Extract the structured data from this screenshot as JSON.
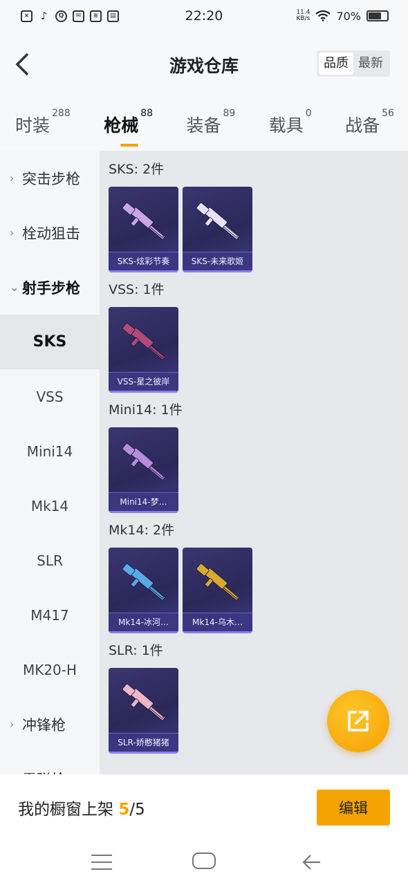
{
  "status_bar": {
    "time": "22:20",
    "net_speed_value": "11.4",
    "net_speed_unit": "KB/s",
    "battery": "70%",
    "battery_level": 0.7,
    "app_icons": [
      "file-icon",
      "tiktok-icon",
      "q-icon",
      "mail-icon",
      "app-icon",
      "card-icon"
    ]
  },
  "header": {
    "title": "游戏仓库",
    "sort_options": [
      "品质",
      "最新"
    ],
    "active_sort": "品质"
  },
  "tabs": [
    {
      "label": "时装",
      "count": "288"
    },
    {
      "label": "枪械",
      "count": "88",
      "active": true
    },
    {
      "label": "装备",
      "count": "89"
    },
    {
      "label": "载具",
      "count": "0"
    },
    {
      "label": "战备",
      "count": "56"
    }
  ],
  "sidebar": {
    "groups": [
      {
        "label": "突击步枪"
      },
      {
        "label": "栓动狙击"
      },
      {
        "label": "射手步枪"
      }
    ],
    "subitems": [
      "SKS",
      "VSS",
      "Mini14",
      "Mk14",
      "SLR",
      "M417",
      "MK20-H"
    ],
    "selected": "SKS",
    "after_groups": [
      {
        "label": "冲锋枪"
      },
      {
        "label": "霰弹枪"
      }
    ]
  },
  "sections": [
    {
      "title": "SKS: 2件",
      "items": [
        {
          "label": "SKS-炫彩节奏",
          "color": "#c9a6e8"
        },
        {
          "label": "SKS-未来歌姬",
          "color": "#e8e0f4"
        }
      ]
    },
    {
      "title": "VSS: 1件",
      "items": [
        {
          "label": "VSS-星之彼岸",
          "color": "#b04a78"
        }
      ]
    },
    {
      "title": "Mini14: 1件",
      "items": [
        {
          "label": "Mini14-梦…",
          "color": "#b78be0"
        }
      ]
    },
    {
      "title": "Mk14: 2件",
      "items": [
        {
          "label": "Mk14-冰河…",
          "color": "#5aa8e8"
        },
        {
          "label": "Mk14-乌木…",
          "color": "#d9a82e"
        }
      ]
    },
    {
      "title": "SLR: 1件",
      "items": [
        {
          "label": "SLR-娇憨猪猪",
          "color": "#f0b6c4"
        }
      ]
    }
  ],
  "bottom_bar": {
    "shelf_label": "我的橱窗上架",
    "shelf_current": "5",
    "shelf_total": "/5",
    "edit_label": "编辑"
  },
  "colors": {
    "accent": "#f5a300",
    "card_bg": "#2f2c62"
  }
}
